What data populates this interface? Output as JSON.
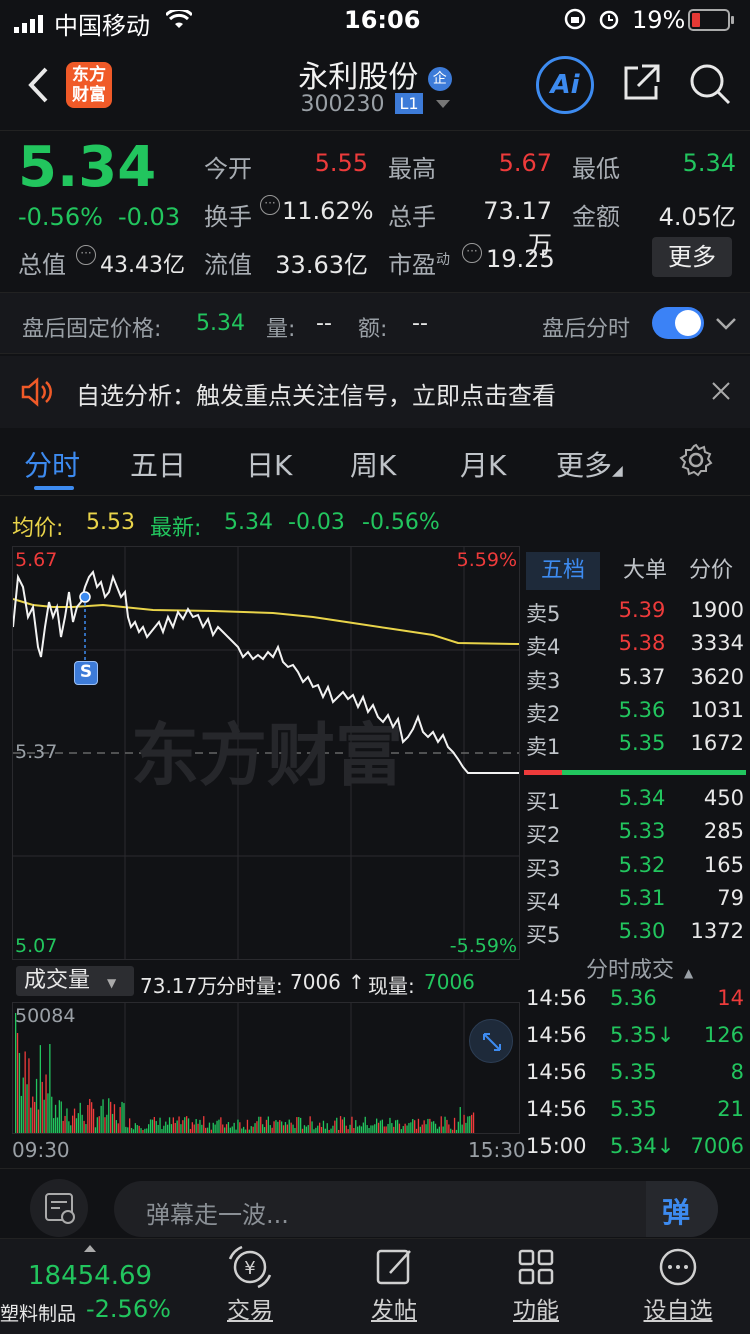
{
  "statusbar": {
    "carrier": "中国移动",
    "time": "16:06",
    "battery": "19%"
  },
  "header": {
    "stock_name": "永利股份",
    "badge": "企",
    "code": "300230",
    "level": "L1",
    "logo_line1": "东方",
    "logo_line2": "财富",
    "ai_label": "Ai"
  },
  "quote": {
    "price": "5.34",
    "pct": "-0.56%",
    "chg": "-0.03",
    "open_label": "今开",
    "open": "5.55",
    "high_label": "最高",
    "high": "5.67",
    "low_label": "最低",
    "low": "5.34",
    "turnover_label": "换手",
    "turnover": "11.62%",
    "volume_label": "总手",
    "volume": "73.17万",
    "amount_label": "金额",
    "amount": "4.05亿",
    "mktcap_label": "总值",
    "mktcap": "43.43亿",
    "float_label": "流值",
    "float": "33.63亿",
    "pe_label": "市盈",
    "pe_sup": "动",
    "pe": "19.25",
    "more_button": "更多"
  },
  "afterhours": {
    "label": "盘后固定价格:",
    "price": "5.34",
    "vol_label": "量:",
    "vol": "--",
    "amt_label": "额:",
    "amt": "--",
    "toggle_label": "盘后分时"
  },
  "alert": {
    "text": "自选分析：触发重点关注信号，立即点击查看"
  },
  "tabs": [
    "分时",
    "五日",
    "日K",
    "周K",
    "月K",
    "更多"
  ],
  "infoline": {
    "avg_label": "均价:",
    "avg": "5.53",
    "latest_label": "最新:",
    "latest": "5.34",
    "chg": "-0.03",
    "pct": "-0.56%"
  },
  "chart": {
    "y_top": "5.67",
    "y_mid": "5.37",
    "y_bottom": "5.07",
    "pct_top": "5.59%",
    "pct_bottom": "-5.59%",
    "watermark": "东方财富",
    "signal": "S",
    "x_start": "09:30",
    "x_end": "15:30"
  },
  "volume": {
    "selector": "成交量",
    "total": "73.17万",
    "period_label": "分时量:",
    "period": "7006",
    "now_label": "现量:",
    "now": "7006",
    "max": "50084"
  },
  "book": {
    "tabs": [
      "五档",
      "大单",
      "分价"
    ],
    "asks": [
      {
        "label": "卖5",
        "price": "5.39",
        "vol": "1900",
        "color": "red"
      },
      {
        "label": "卖4",
        "price": "5.38",
        "vol": "3334",
        "color": "red"
      },
      {
        "label": "卖3",
        "price": "5.37",
        "vol": "3620",
        "color": "white"
      },
      {
        "label": "卖2",
        "price": "5.36",
        "vol": "1031",
        "color": "green"
      },
      {
        "label": "卖1",
        "price": "5.35",
        "vol": "1672",
        "color": "green"
      }
    ],
    "bids": [
      {
        "label": "买1",
        "price": "5.34",
        "vol": "450",
        "color": "green"
      },
      {
        "label": "买2",
        "price": "5.33",
        "vol": "285",
        "color": "green"
      },
      {
        "label": "买3",
        "price": "5.32",
        "vol": "165",
        "color": "green"
      },
      {
        "label": "买4",
        "price": "5.31",
        "vol": "79",
        "color": "green"
      },
      {
        "label": "买5",
        "price": "5.30",
        "vol": "1372",
        "color": "green"
      }
    ]
  },
  "ticks": {
    "title": "分时成交",
    "rows": [
      {
        "time": "14:56",
        "price": "5.36",
        "vol": "14",
        "vcolor": "red"
      },
      {
        "time": "14:56",
        "price": "5.35↓",
        "vol": "126",
        "vcolor": "green"
      },
      {
        "time": "14:56",
        "price": "5.35",
        "vol": "8",
        "vcolor": "green"
      },
      {
        "time": "14:56",
        "price": "5.35",
        "vol": "21",
        "vcolor": "green"
      },
      {
        "time": "15:00",
        "price": "5.34↓",
        "vol": "7006",
        "vcolor": "green"
      }
    ]
  },
  "comment": {
    "placeholder": "弹幕走一波...",
    "danmu_icon": "弹"
  },
  "bottomnav": {
    "index_value": "18454.69",
    "index_name": "塑料制品",
    "index_pct": "-2.56%",
    "items": [
      "交易",
      "发帖",
      "功能",
      "设自选"
    ]
  }
}
